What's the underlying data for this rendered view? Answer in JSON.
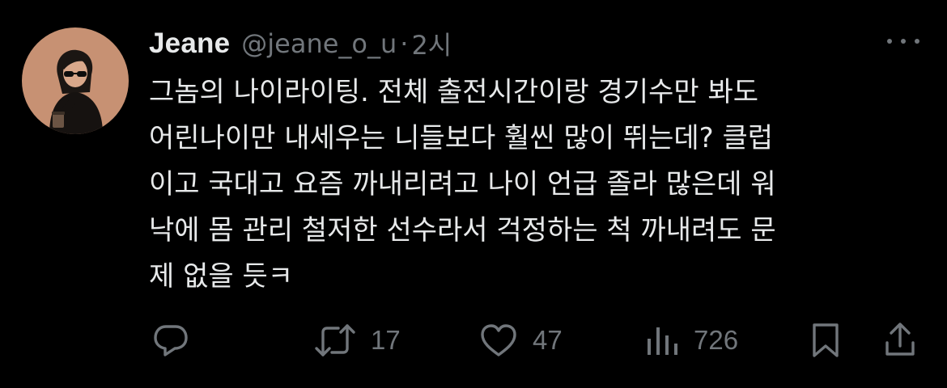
{
  "tweet": {
    "display_name": "Jeane",
    "handle": "@jeane_o_u",
    "separator": "·",
    "time": "2시",
    "lines": [
      "그놈의 나이라이팅. 전체 출전시간이랑 경기수만 봐도",
      "어린나이만 내세우는 니들보다 훨씬 많이 뛰는데? 클럽",
      "이고 국대고 요즘 까내리려고 나이 언급 졸라 많은데 워",
      "낙에 몸 관리 철저한 선수라서 걱정하는 척 까내려도 문",
      "제 없을 듯ㅋ"
    ]
  },
  "actions": {
    "reply": {
      "icon": "reply-icon"
    },
    "retweet": {
      "icon": "retweet-icon",
      "count": "17"
    },
    "like": {
      "icon": "heart-icon",
      "count": "47"
    },
    "views": {
      "icon": "views-icon",
      "count": "726"
    },
    "bookmark": {
      "icon": "bookmark-icon"
    },
    "share": {
      "icon": "share-icon"
    }
  },
  "colors": {
    "background": "#000000",
    "primary_text": "#e7e9ea",
    "secondary_text": "#71767b",
    "avatar_bg": "#c79173"
  }
}
